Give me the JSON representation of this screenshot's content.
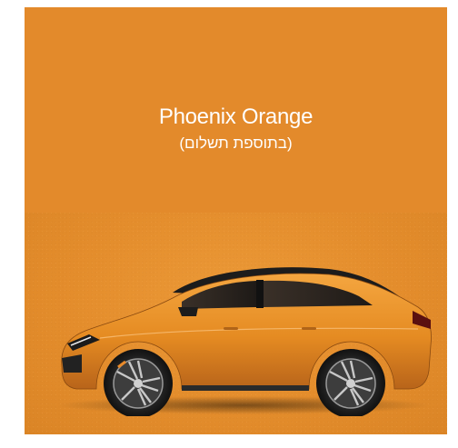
{
  "swatch": {
    "color_name": "Phoenix Orange",
    "price_note": "(בתוספת תשלום)",
    "colors": {
      "background": "#E38A2B",
      "text": "#ffffff"
    }
  },
  "image": {
    "subject": "car-side-view-icon"
  }
}
